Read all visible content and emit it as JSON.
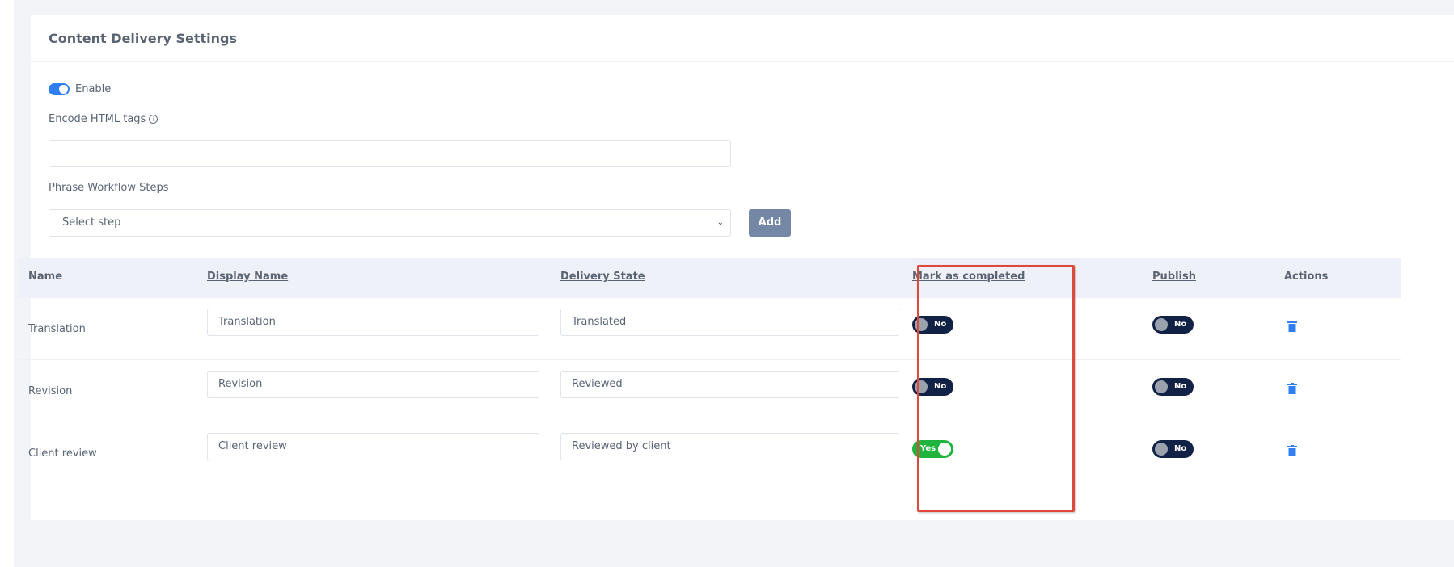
{
  "card": {
    "title": "Content Delivery Settings"
  },
  "enable": {
    "label": "Enable",
    "on": true
  },
  "encode": {
    "label": "Encode HTML tags",
    "info_icon": "info-circle-icon",
    "value": ""
  },
  "workflow": {
    "label": "Phrase Workflow Steps",
    "select_value": "Select step",
    "add_label": "Add"
  },
  "table": {
    "headers": {
      "name": "Name",
      "display_name": "Display Name",
      "delivery_state": "Delivery State",
      "mark_completed": "Mark as completed",
      "publish": "Publish",
      "actions": "Actions"
    },
    "rows": [
      {
        "name": "Translation",
        "display_name": "Translation",
        "delivery_state": "Translated",
        "mark_completed": "No",
        "publish": "No"
      },
      {
        "name": "Revision",
        "display_name": "Revision",
        "delivery_state": "Reviewed",
        "mark_completed": "No",
        "publish": "No"
      },
      {
        "name": "Client review",
        "display_name": "Client review",
        "delivery_state": "Reviewed by client",
        "mark_completed": "Yes",
        "publish": "No"
      }
    ]
  },
  "colors": {
    "toggle_off": "#122247",
    "toggle_on": "#1fb43e",
    "accent": "#2f7ff2",
    "highlight": "#e0483b",
    "trash": "#2f7ff2"
  }
}
